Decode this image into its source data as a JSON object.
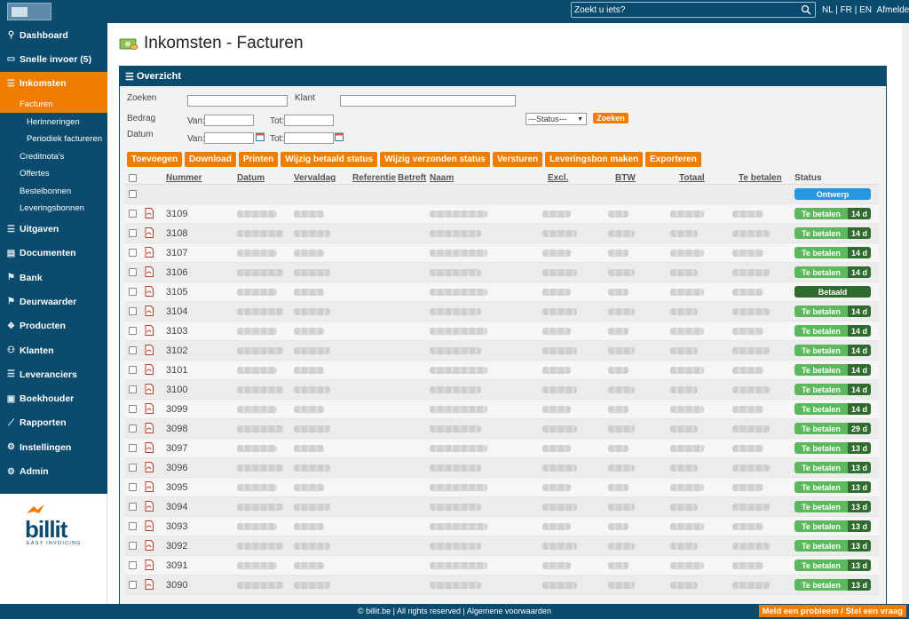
{
  "topbar": {
    "search_placeholder": "Zoekt u iets?",
    "lang_nl": "NL",
    "lang_fr": "FR",
    "lang_en": "EN",
    "logout": "Afmelden"
  },
  "sidebar": {
    "items": [
      {
        "label": "Dashboard",
        "icon": "gauge-icon"
      },
      {
        "label": "Snelle invoer (5)",
        "icon": "inbox-icon"
      },
      {
        "label": "Inkomsten",
        "icon": "list-icon",
        "active": true
      },
      {
        "label": "Uitgaven",
        "icon": "list-icon"
      },
      {
        "label": "Documenten",
        "icon": "document-icon"
      },
      {
        "label": "Bank",
        "icon": "flag-icon"
      },
      {
        "label": "Deurwaarder",
        "icon": "flag-icon"
      },
      {
        "label": "Producten",
        "icon": "cube-icon"
      },
      {
        "label": "Klanten",
        "icon": "users-icon"
      },
      {
        "label": "Leveranciers",
        "icon": "truck-icon"
      },
      {
        "label": "Boekhouder",
        "icon": "book-icon"
      },
      {
        "label": "Rapporten",
        "icon": "chart-icon"
      },
      {
        "label": "Instellingen",
        "icon": "gear-icon"
      },
      {
        "label": "Admin",
        "icon": "gear-icon"
      }
    ],
    "subitems": {
      "facturen": "Facturen",
      "herinneringen": "Herinneringen",
      "periodiek": "Periodiek factureren",
      "creditnotas": "Creditnota's",
      "offertes": "Offertes",
      "bestelbonnen": "Bestelbonnen",
      "leveringsbonnen": "Leveringsbonnen"
    },
    "brand_name": "billit",
    "brand_tagline": "EASY INVOICING"
  },
  "page": {
    "title": "Inkomsten - Facturen",
    "panel_title": "Overzicht"
  },
  "filters": {
    "zoeken_label": "Zoeken",
    "klant_label": "Klant",
    "status_value": "---Status---",
    "search_button": "Zoeken",
    "bedrag_label": "Bedrag",
    "datum_label": "Datum",
    "van_label": "Van:",
    "tot_label": "Tot:"
  },
  "actions": [
    "Toevoegen",
    "Download",
    "Printen",
    "Wijzig betaald status",
    "Wijzig verzonden status",
    "Versturen",
    "Leveringsbon maken",
    "Exporteren"
  ],
  "table": {
    "headers": {
      "nummer": "Nummer",
      "datum": "Datum",
      "vervaldag": "Vervaldag",
      "referentie": "Referentie",
      "betreft": "Betreft",
      "naam": "Naam",
      "excl": "Excl.",
      "btw": "BTW",
      "totaal": "Totaal",
      "te_betalen": "Te betalen",
      "status": "Status"
    },
    "rows": [
      {
        "number": "",
        "status": "Ontwerp",
        "days": "",
        "type": "ontwerp",
        "pdf": false
      },
      {
        "number": "3109",
        "status": "Te betalen",
        "days": "14 d",
        "type": "tebetalen",
        "pdf": true
      },
      {
        "number": "3108",
        "status": "Te betalen",
        "days": "14 d",
        "type": "tebetalen",
        "pdf": true
      },
      {
        "number": "3107",
        "status": "Te betalen",
        "days": "14 d",
        "type": "tebetalen",
        "pdf": true
      },
      {
        "number": "3106",
        "status": "Te betalen",
        "days": "14 d",
        "type": "tebetalen",
        "pdf": true
      },
      {
        "number": "3105",
        "status": "Betaald",
        "days": "",
        "type": "betaald",
        "pdf": true
      },
      {
        "number": "3104",
        "status": "Te betalen",
        "days": "14 d",
        "type": "tebetalen",
        "pdf": true
      },
      {
        "number": "3103",
        "status": "Te betalen",
        "days": "14 d",
        "type": "tebetalen",
        "pdf": true
      },
      {
        "number": "3102",
        "status": "Te betalen",
        "days": "14 d",
        "type": "tebetalen",
        "pdf": true
      },
      {
        "number": "3101",
        "status": "Te betalen",
        "days": "14 d",
        "type": "tebetalen",
        "pdf": true
      },
      {
        "number": "3100",
        "status": "Te betalen",
        "days": "14 d",
        "type": "tebetalen",
        "pdf": true
      },
      {
        "number": "3099",
        "status": "Te betalen",
        "days": "14 d",
        "type": "tebetalen",
        "pdf": true
      },
      {
        "number": "3098",
        "status": "Te betalen",
        "days": "29 d",
        "type": "tebetalen",
        "pdf": true
      },
      {
        "number": "3097",
        "status": "Te betalen",
        "days": "13 d",
        "type": "tebetalen",
        "pdf": true
      },
      {
        "number": "3096",
        "status": "Te betalen",
        "days": "13 d",
        "type": "tebetalen",
        "pdf": true
      },
      {
        "number": "3095",
        "status": "Te betalen",
        "days": "13 d",
        "type": "tebetalen",
        "pdf": true
      },
      {
        "number": "3094",
        "status": "Te betalen",
        "days": "13 d",
        "type": "tebetalen",
        "pdf": true
      },
      {
        "number": "3093",
        "status": "Te betalen",
        "days": "13 d",
        "type": "tebetalen",
        "pdf": true
      },
      {
        "number": "3092",
        "status": "Te betalen",
        "days": "13 d",
        "type": "tebetalen",
        "pdf": true
      },
      {
        "number": "3091",
        "status": "Te betalen",
        "days": "13 d",
        "type": "tebetalen",
        "pdf": true
      },
      {
        "number": "3090",
        "status": "Te betalen",
        "days": "13 d",
        "type": "tebetalen",
        "pdf": true
      }
    ]
  },
  "footer": {
    "text": "© billit.be | All rights reserved | Algemene voorwaarden",
    "report_button": "Meld een probleem / Stel een vraag"
  },
  "colors": {
    "primary": "#0b4b6e",
    "accent": "#f07d00",
    "ontwerp": "#2596e0",
    "tebetalen": "#5cb85c",
    "betaald": "#2f6a2f"
  }
}
